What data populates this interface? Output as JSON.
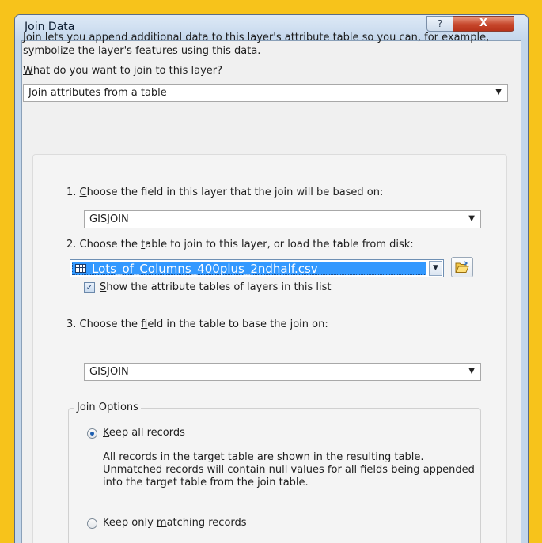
{
  "window": {
    "title": "Join Data",
    "help_glyph": "?",
    "close_glyph": "X"
  },
  "intro_text": "Join lets you append additional data to this layer's attribute table so you can, for example, symbolize the layer's features using this data.",
  "question": {
    "accel": "W",
    "rest": "hat do you want to join to this layer?"
  },
  "join_type": {
    "selected": "Join attributes from a table"
  },
  "step1": {
    "number": "1.",
    "accel": "C",
    "rest": "hoose the field in this layer that the join will be based on:",
    "value": "GISJOIN"
  },
  "step2": {
    "number": "2.",
    "before": "Choose the ",
    "accel": "t",
    "after": "able to join to this layer, or load the table from disk:",
    "value": "Lots_of_Columns_400plus_2ndhalf.csv",
    "checkbox_accel": "S",
    "checkbox_rest": "how the attribute tables of layers in this list",
    "checkbox_checked": true
  },
  "step3": {
    "number": "3.",
    "before": "Choose the ",
    "accel": "f",
    "after": "ield in the table to base the join on:",
    "value": "GISJOIN"
  },
  "join_options": {
    "legend": "Join Options",
    "keep_all_accel": "K",
    "keep_all_rest": "eep all records",
    "keep_all_selected": true,
    "keep_all_description": "All records in the target table are shown in the resulting table. Unmatched records will contain null values for all fields being appended into the target table from the join table.",
    "keep_matching_before": "Keep only ",
    "keep_matching_accel": "m",
    "keep_matching_after": "atching records"
  },
  "icons": {
    "dropdown": "triangle-down",
    "table": "table-grid-icon",
    "browse": "folder-open-icon"
  },
  "colors": {
    "frame_background": "#f7c31b",
    "selection": "#3399ff",
    "close_button": "#c6472c"
  }
}
